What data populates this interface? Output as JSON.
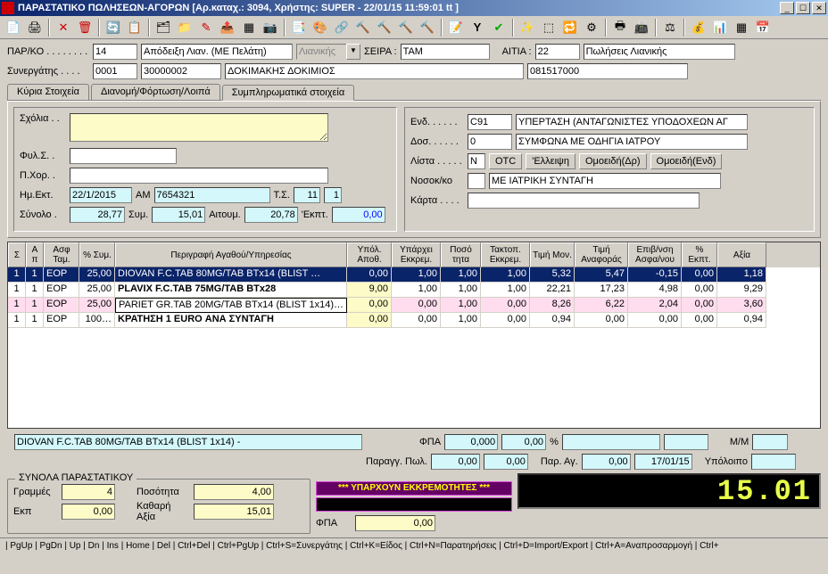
{
  "window": {
    "title": "ΠΑΡΑΣΤΑΤΙΚΟ ΠΩΛΗΣΕΩΝ-ΑΓΟΡΩΝ [Αρ.καταχ.: 3094, Χρήστης: SUPER - 22/01/15 11:59:01 tt ]"
  },
  "header": {
    "parko_label": "ΠΑΡ/ΚΟ . . . . . . . .",
    "parko": "14",
    "doctype": "Απόδειξη Λιαν. (ΜΕ Πελάτη)",
    "lianikis": "Λιανικής",
    "seira_label": "ΣΕΙΡΑ :",
    "seira": "TAM",
    "aitia_label": "ΑΙΤΙΑ :",
    "aitia": "22",
    "aitia_desc": "Πωλήσεις Λιανικής",
    "synergatis_label": "Συνεργάτης . . . .",
    "syn1": "0001",
    "syn2": "30000002",
    "syn_name": "ΔΟΚΙΜΑΚΗΣ ΔΟΚΙΜΙΟΣ",
    "syn_code": "081517000"
  },
  "tabs": {
    "t1": "Κύρια Στοιχεία",
    "t2": "Διανομή/Φόρτωση/Λοιπά",
    "t3": "Συμπληρωματικά στοιχεία"
  },
  "supp": {
    "sxolia_label": "Σχόλια . .",
    "fyls_label": "Φυλ.Σ. .",
    "pxor_label": "Π.Χορ. .",
    "imekt_label": "Ημ.Εκτ.",
    "imekt": "22/1/2015",
    "am_label": "AM",
    "am": "7654321",
    "ts_label": "Τ.Σ.",
    "ts": "11",
    "ts2": "1",
    "synolo_label": "Σύνολο .",
    "synolo": "28,77",
    "sym_label": "Συμ.",
    "sym": "15,01",
    "aitoum_label": "Αιτουμ.",
    "aitoum": "20,78",
    "ekpt_label": "'Εκπτ.",
    "ekpt": "0,00",
    "end_label": "Ενδ. . . . . .",
    "end": "C91",
    "end_desc": "ΥΠΕΡΤΑΣΗ (ΑΝΤΑΓΩΝΙΣΤΕΣ ΥΠΟΔΟΧΕΩΝ ΑΓ",
    "dos_label": "Δοσ. . . . . .",
    "dos": "0",
    "dos_desc": "ΣΥΜΦΩΝΑ ΜΕ ΟΔΗΓΙΑ ΙΑΤΡΟΥ",
    "lista_label": "Λίστα . . . . .",
    "lista": "N",
    "lista_b1": "OTC",
    "lista_b2": "'Ελλειψη",
    "lista_b3": "Ομοειδή(Δρ)",
    "lista_b4": "Ομοειδή(Ενδ)",
    "nosok_label": "Νοσοκ/κο",
    "nosok_desc": "ΜΕ ΙΑΤΡΙΚΗ ΣΥΝΤΑΓΗ",
    "karta_label": "Κάρτα . . . ."
  },
  "grid": {
    "headers": {
      "s": "Σ",
      "a": "Α π",
      "at": "Ασφ Ταμ.",
      "pct": "% Συμ.",
      "desc": "Περιγραφή Αγαθού/Υπηρεσίας",
      "ya": "Υπόλ. Αποθ.",
      "ye": "Υπάρχει Εκκρεμ.",
      "pos": "Ποσό τητα",
      "te": "Τακτοπ. Εκκρεμ.",
      "tm": "Τιμή Μον.",
      "ta": "Τιμή Αναφοράς",
      "ev": "Επιβ/νση Ασφα/νου",
      "pe": "% Εκπτ.",
      "ax": "Αξία"
    },
    "rows": [
      {
        "s": "1",
        "a": "1",
        "at": "EOP",
        "pct": "25,00",
        "desc": "DIOVAN F.C.TAB 80MG/TAB BTx14 (BLIST …",
        "ya": "0,00",
        "ye": "1,00",
        "pos": "1,00",
        "te": "1,00",
        "tm": "5,32",
        "ta": "5,47",
        "ev": "-0,15",
        "pe": "0,00",
        "ax": "1,18",
        "sel": true
      },
      {
        "s": "1",
        "a": "1",
        "at": "EOP",
        "pct": "25,00",
        "desc": "PLAVIX F.C.TAB 75MG/TAB BTx28",
        "ya": "9,00",
        "ye": "1,00",
        "pos": "1,00",
        "te": "1,00",
        "tm": "22,21",
        "ta": "17,23",
        "ev": "4,98",
        "pe": "0,00",
        "ax": "9,29"
      },
      {
        "s": "1",
        "a": "1",
        "at": "EOP",
        "pct": "25,00",
        "desc": "PARIET GR.TAB 20MG/TAB BTx14 (BLIST 1x14)…",
        "ya": "0,00",
        "ye": "0,00",
        "pos": "1,00",
        "te": "0,00",
        "tm": "8,26",
        "ta": "6,22",
        "ev": "2,04",
        "pe": "0,00",
        "ax": "3,60",
        "pink": true,
        "edit": true
      },
      {
        "s": "1",
        "a": "1",
        "at": "EOP",
        "pct": "100…",
        "desc": "ΚΡΑΤΗΣΗ 1 EURO ΑΝΑ ΣΥΝΤΑΓΗ",
        "ya": "0,00",
        "ye": "0,00",
        "pos": "1,00",
        "te": "0,00",
        "tm": "0,94",
        "ta": "0,00",
        "ev": "0,00",
        "pe": "0,00",
        "ax": "0,94"
      }
    ]
  },
  "detail_bar": {
    "text": "DIOVAN F.C.TAB 80MG/TAB BTx14 (BLIST 1x14) -",
    "fpa_label": "ΦΠΑ",
    "fpa1": "0,000",
    "fpa2": "0,00",
    "pct": "%",
    "mm_label": "M/M",
    "paragg_label": "Παραγγ. Πωλ.",
    "paragg1": "0,00",
    "paragg2": "0,00",
    "parag_label": "Παρ. Αγ.",
    "parag1": "0,00",
    "parag_date": "17/01/15",
    "ypol_label": "Υπόλοιπο"
  },
  "totals": {
    "legend": "ΣΥΝΟΛΑ ΠΑΡΑΣΤΑΤΙΚΟΥ",
    "grammes_label": "Γραμμές",
    "grammes": "4",
    "ekp_label": "Εκπ",
    "ekp": "0,00",
    "posot_label": "Ποσότητα",
    "posot": "4,00",
    "kath_label": "Καθαρή Αξία",
    "kath": "15,01",
    "fpa_label": "ΦΠΑ",
    "fpa": "0,00",
    "alert": "*** ΥΠΑΡΧΟΥΝ ΕΚΚΡΕΜΟΤΗΤΕΣ ***",
    "lcd": "15.01"
  },
  "footer": {
    "text": "| PgUp | PgDn | Up | Dn | Ins | Home | Del | Ctrl+Del | Ctrl+PgUp | Ctrl+S=Συνεργάτης | Ctrl+K=Είδος | Ctrl+N=Παρατηρήσεις | Ctrl+D=Import/Export | Ctrl+A=Αναπροσαρμογή | Ctrl+"
  }
}
